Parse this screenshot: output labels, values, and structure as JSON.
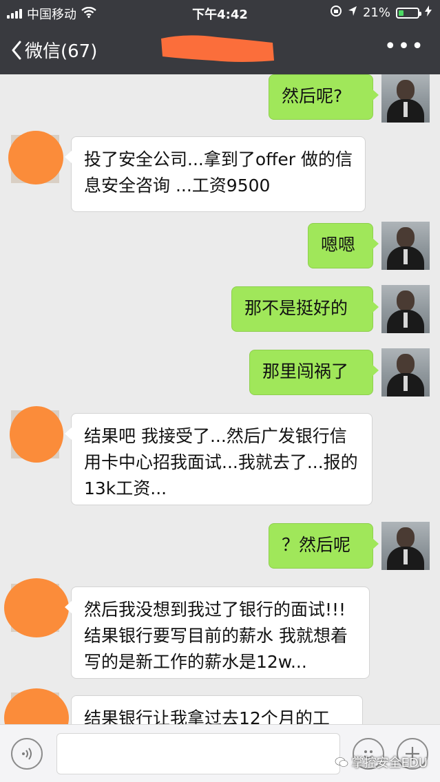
{
  "status_bar": {
    "carrier": "中国移动",
    "time": "下午4:42",
    "battery_percent": "21%",
    "icons": [
      "signal-icon",
      "wifi-icon",
      "orientation-lock-icon",
      "location-icon",
      "battery-icon",
      "charging-icon"
    ],
    "battery_color": "#4cd964"
  },
  "nav": {
    "back_label": "微信(67)",
    "more_label": "•••",
    "title_redacted": true,
    "background": "#393a3f"
  },
  "messages": [
    {
      "side": "right",
      "text": "然后呢?"
    },
    {
      "side": "left",
      "text": "投了安全公司...拿到了offer 做的信息安全咨询 ...工资9500"
    },
    {
      "side": "right",
      "text": "嗯嗯"
    },
    {
      "side": "right",
      "text": "那不是挺好的"
    },
    {
      "side": "right",
      "text": "那里闯祸了"
    },
    {
      "side": "left",
      "text": "结果吧 我接受了...然后广发银行信用卡中心招我面试...我就去了...报的13k工资..."
    },
    {
      "side": "right",
      "text": "？然后呢"
    },
    {
      "side": "left",
      "text": "然后我没想到我过了银行的面试!!!结果银行要写目前的薪水 我就想着写的是新工作的薪水是12w..."
    },
    {
      "side": "left",
      "text": "结果银行让我拿过去12个月的工"
    }
  ],
  "colors": {
    "outgoing_bubble": "#a0e75a",
    "incoming_bubble": "#ffffff",
    "chat_background": "#ebebeb",
    "redaction": "#fb8c3a"
  },
  "input_bar": {
    "voice_icon": "voice-icon",
    "emoji_icon": "emoji-icon",
    "plus_icon": "plus-icon",
    "input_value": ""
  },
  "watermark": {
    "text": "掌控安全EDU",
    "icon": "wechat-official-account-icon"
  }
}
